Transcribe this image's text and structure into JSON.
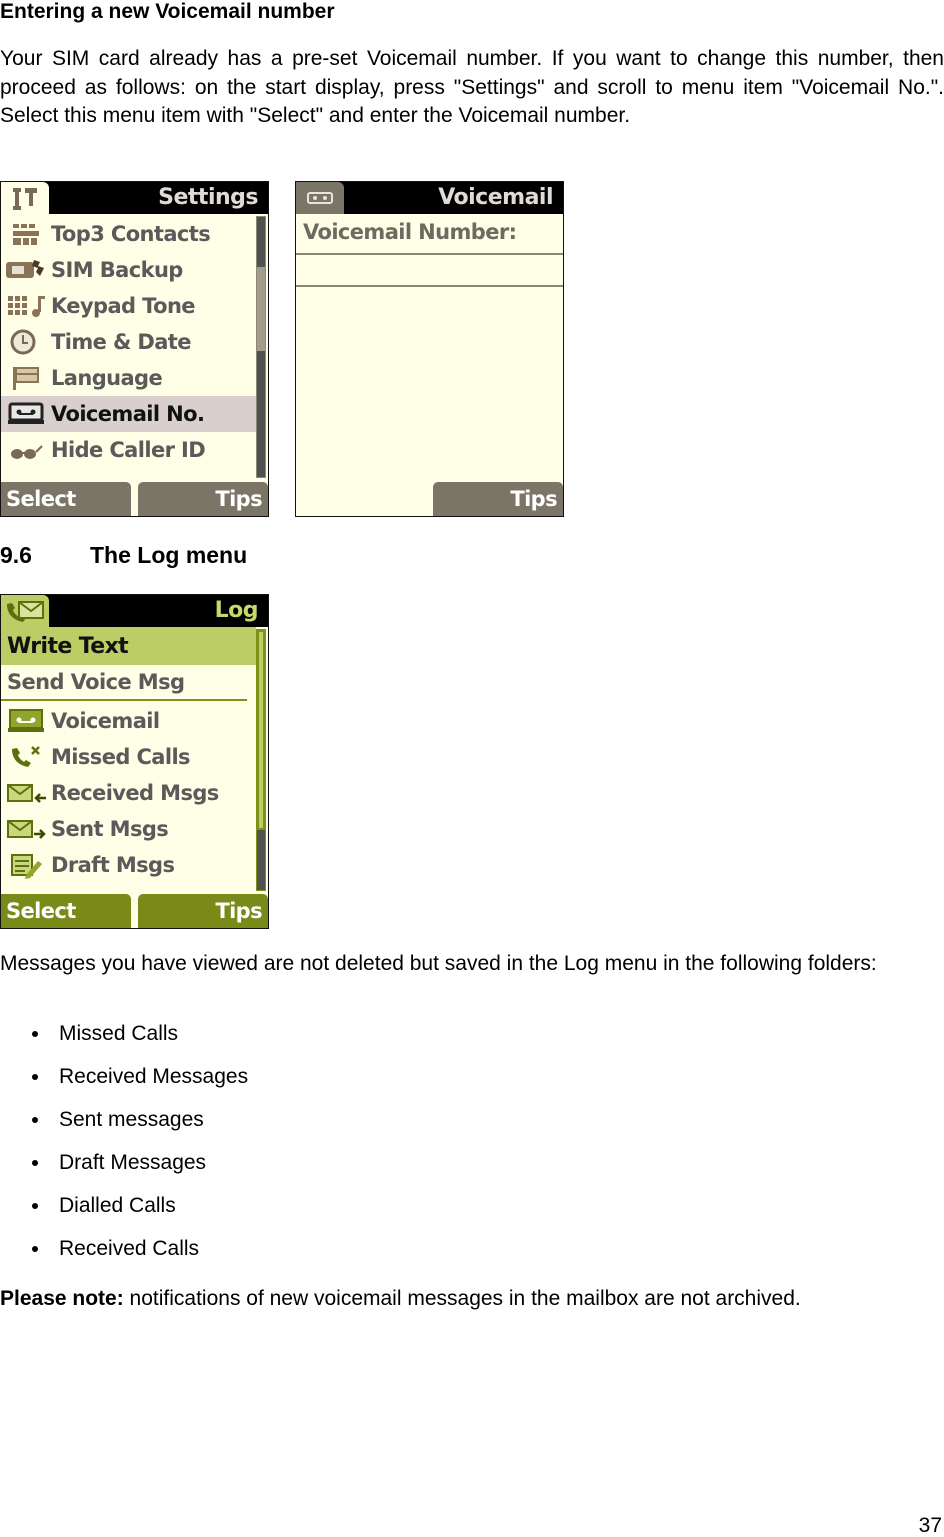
{
  "section_heading": "Entering a new Voicemail number",
  "intro_paragraph": "Your SIM card already has a pre-set Voicemail number. If you want to change this number, then proceed as follows: on the start display, press \"Settings\" and scroll to menu item \"Voicemail No.\". Select this menu item with \"Select\" and enter the Voicemail number.",
  "settings_screen": {
    "title": "Settings",
    "tab_icon": "tools-icon",
    "items": [
      {
        "label": "Top3 Contacts",
        "icon": "contacts-grid-icon",
        "selected": false
      },
      {
        "label": "SIM Backup",
        "icon": "sim-backup-icon",
        "selected": false
      },
      {
        "label": "Keypad Tone",
        "icon": "keypad-tone-icon",
        "selected": false
      },
      {
        "label": "Time & Date",
        "icon": "clock-icon",
        "selected": false
      },
      {
        "label": "Language",
        "icon": "flag-icon",
        "selected": false
      },
      {
        "label": "Voicemail No.",
        "icon": "voicemail-icon",
        "selected": true
      },
      {
        "label": "Hide Caller ID",
        "icon": "glasses-icon",
        "selected": false
      }
    ],
    "softkey_left": "Select",
    "softkey_right": "Tips",
    "colors": {
      "background": "#fffee6",
      "text": "#5a5a5a",
      "selected_bg": "#d9d0ce",
      "softkey": "#7a7566",
      "icon": "#8b7358"
    }
  },
  "voicemail_screen": {
    "title": "Voicemail",
    "tab_icon": "voicemail-icon",
    "field_label": "Voicemail Number:",
    "field_value": "",
    "softkey_right": "Tips",
    "colors": {
      "background": "#fffee6",
      "text": "#6b6b60",
      "softkey": "#7a7566"
    }
  },
  "log_heading": {
    "number": "9.6",
    "title": "The Log menu"
  },
  "log_screen": {
    "title": "Log",
    "tab_icon": "call-envelope-icon",
    "highlighted_item": "Write Text",
    "second_item": "Send Voice Msg",
    "items": [
      {
        "label": "Voicemail",
        "icon": "voicemail-icon"
      },
      {
        "label": "Missed Calls",
        "icon": "missed-call-icon"
      },
      {
        "label": "Received Msgs",
        "icon": "received-msg-icon"
      },
      {
        "label": "Sent Msgs",
        "icon": "sent-msg-icon"
      },
      {
        "label": "Draft Msgs",
        "icon": "draft-msg-icon"
      }
    ],
    "softkey_left": "Select",
    "softkey_right": "Tips",
    "colors": {
      "background": "#fffee6",
      "highlight": "#bccd66",
      "accent": "#7e9219",
      "title": "#c6d96a",
      "softkey": "#7a8a18"
    }
  },
  "log_paragraph": "Messages you have viewed are not deleted but saved in the Log menu in the following folders:",
  "log_folders": [
    "Missed Calls",
    "Received Messages",
    "Sent messages",
    "Draft Messages",
    "Dialled Calls",
    "Received Calls"
  ],
  "note": {
    "label": "Please note:",
    "text": " notifications of new voicemail messages in the mailbox are not archived."
  },
  "page_number": "37"
}
